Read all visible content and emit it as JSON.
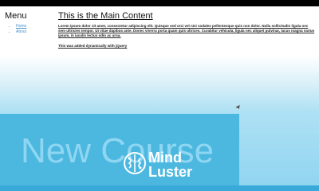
{
  "sidebar": {
    "title": "Menu",
    "items": [
      {
        "label": "Home"
      },
      {
        "label": "About"
      }
    ]
  },
  "main": {
    "title": "This is the Main Content",
    "paragraph": "Lorem ipsum dolor sit amet, consectetur adipiscing elit. Quisque sed orci vel nisi sodales pellentesque quis non dolor. Nulla sollicitudin ligula nec sem ultricies tempor. Ut vitae dapibus ante. Donec viverra porta quam quis ultrices. Curabitur vehicula, ligula nec aliquet pulvinar, lacus magna varius ipsum, in iaculis lectus odio ac urna.",
    "dynamic_text": "This was added dynamically with jQuery"
  },
  "banner": {
    "text": "New Course",
    "brand_line1": "Mind",
    "brand_line2": "Luster"
  },
  "colors": {
    "banner": "#4cb8df",
    "link": "#4a90c8",
    "bottom_bar": "#39a9d9"
  },
  "icons": {
    "brand_logo": "brain-icon",
    "cursor": "mouse-pointer-icon"
  }
}
